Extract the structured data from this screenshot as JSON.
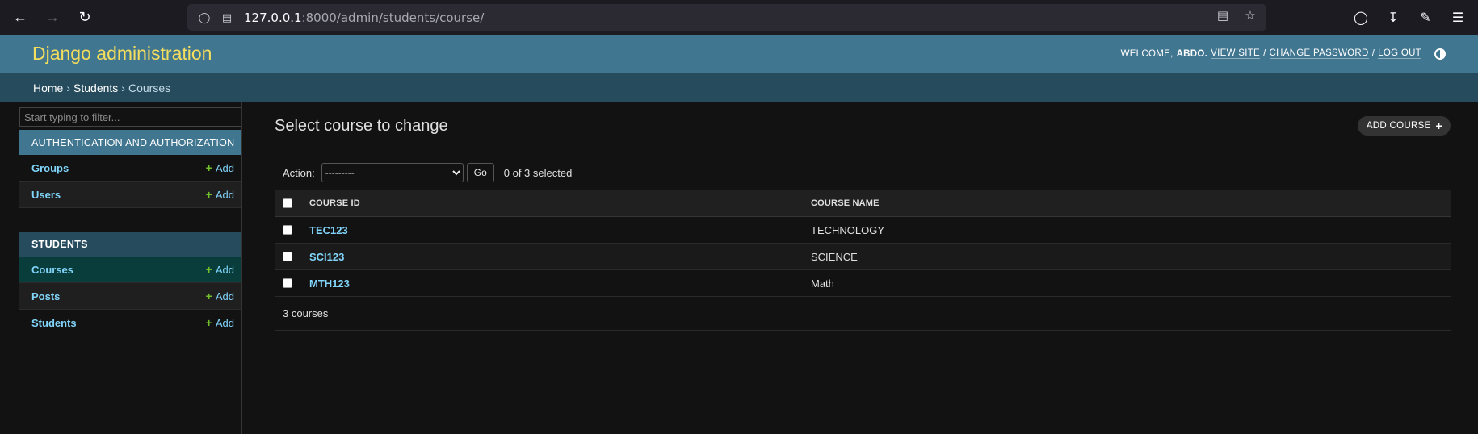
{
  "browser": {
    "url_host": "127.0.0.1",
    "url_rest": ":8000/admin/students/course/"
  },
  "header": {
    "branding": "Django administration",
    "welcome": "Welcome,",
    "username": "abdo.",
    "view_site": "View site",
    "change_password": "Change password",
    "log_out": "Log out",
    "separator": "/"
  },
  "breadcrumbs": {
    "home": "Home",
    "app": "Students",
    "current": "Courses",
    "sep": "›"
  },
  "sidebar": {
    "filter_placeholder": "Start typing to filter...",
    "modules": [
      {
        "caption": "Authentication and Authorization",
        "models": [
          {
            "name": "Groups",
            "add": "Add"
          },
          {
            "name": "Users",
            "add": "Add"
          }
        ]
      },
      {
        "caption": "Students",
        "models": [
          {
            "name": "Courses",
            "add": "Add"
          },
          {
            "name": "Posts",
            "add": "Add"
          },
          {
            "name": "Students",
            "add": "Add"
          }
        ]
      }
    ]
  },
  "main": {
    "title": "Select course to change",
    "add_button": "Add course",
    "action_label": "Action:",
    "action_selected": "---------",
    "go_label": "Go",
    "selection_count": "0 of 3 selected",
    "columns": [
      "Course ID",
      "Course name"
    ],
    "rows": [
      {
        "id": "TEC123",
        "name": "TECHNOLOGY"
      },
      {
        "id": "SCI123",
        "name": "SCIENCE"
      },
      {
        "id": "MTH123",
        "name": "Math"
      }
    ],
    "paginator": "3 courses"
  },
  "colors": {
    "header_bg": "#417690",
    "branding": "#f5dd5d",
    "breadcrumbs_bg": "#264b5d",
    "link": "#81d4fa",
    "add_plus": "#70bf2b",
    "current_row": "#083d3b"
  }
}
